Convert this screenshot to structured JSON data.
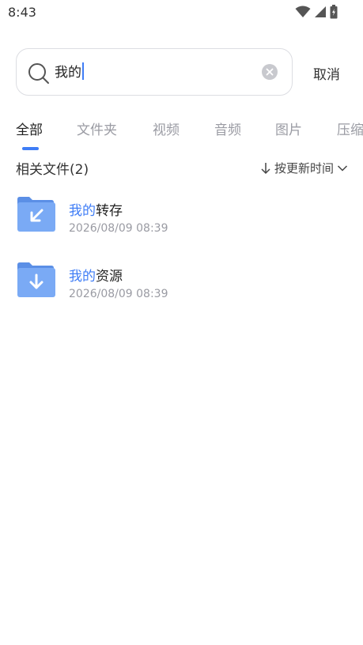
{
  "status": {
    "time": "8:43"
  },
  "search": {
    "query": "我的"
  },
  "cancel_label": "取消",
  "tabs": [
    {
      "label": "全部"
    },
    {
      "label": "文件夹"
    },
    {
      "label": "视频"
    },
    {
      "label": "音频"
    },
    {
      "label": "图片"
    },
    {
      "label": "压缩"
    }
  ],
  "results": {
    "title": "相关文件(2)",
    "sort_label": "按更新时间"
  },
  "items": [
    {
      "highlight": "我的",
      "rest": "转存",
      "date": "2026/08/09 08:39",
      "icon": "folder-transfer-icon"
    },
    {
      "highlight": "我的",
      "rest": "资源",
      "date": "2026/08/09 08:39",
      "icon": "folder-download-icon"
    }
  ],
  "colors": {
    "accent": "#3f7df6",
    "folder": "#7aaaf5",
    "muted": "#9a9ba3"
  }
}
